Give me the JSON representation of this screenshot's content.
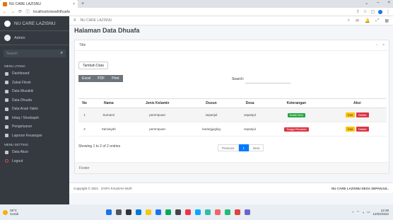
{
  "browser": {
    "tab_title": "NU CARE LAZISNU",
    "tab_close": "×",
    "new_tab": "+",
    "url": "localhost/ziswaf/dhuafa",
    "window_controls": [
      "⌄",
      "–",
      "×"
    ]
  },
  "sidebar": {
    "brand": "NU CARE LAZISNU",
    "user": "Admin",
    "search_placeholder": "Search",
    "header_menu": "MENU UTAMA",
    "items": [
      {
        "label": "Dashboard",
        "icon": "dashboard-icon"
      },
      {
        "label": "Zakat Fitrah",
        "icon": "table-icon"
      },
      {
        "label": "Data Muzakki",
        "icon": "table-icon"
      },
      {
        "label": "Data Dhuafa",
        "icon": "table-icon"
      },
      {
        "label": "Data Anak Yatim",
        "icon": "table-icon"
      },
      {
        "label": "Infaq / Shodaqoh",
        "icon": "table-icon"
      },
      {
        "label": "Pengeluaran",
        "icon": "table-icon"
      },
      {
        "label": "Laporan Keuangan",
        "icon": "table-icon"
      }
    ],
    "header_setting": "MENU SETTING",
    "items2": [
      {
        "label": "Data Akun",
        "icon": "table-icon"
      },
      {
        "label": "Logout",
        "icon": "circle-icon"
      }
    ]
  },
  "topnav": {
    "title": "NU CARE LAZISNU"
  },
  "page": {
    "heading": "Halaman Data Dhuafa",
    "card_title": "Title",
    "add_button": "Tambah Data",
    "exports": [
      "Excel",
      "PDF",
      "Print"
    ],
    "search_label": "Search:",
    "columns": [
      "No",
      "Nama",
      "Jenis Kelamin",
      "Dusun",
      "Desa",
      "Keterangan",
      "Aksi"
    ],
    "rows": [
      {
        "no": "1",
        "nama": "Sumarni",
        "jk": "perempuan",
        "dusun": "sepanjul",
        "desa": "sepanjul",
        "ket": "Sudah Kirim",
        "ket_color": "#28a745"
      },
      {
        "no": "2",
        "nama": "Samaiyah",
        "jk": "perempuan",
        "dusun": "karangjoglog",
        "desa": "sepanjul",
        "ket": "Tunggu Pencairan",
        "ket_color": "#dc3545"
      }
    ],
    "edit_label": "Edit",
    "delete_label": "Delete",
    "showing": "Showing 1 to 2 of 2 entries",
    "pager": [
      "Previous",
      "1",
      "Next"
    ],
    "card_footer": "Footer"
  },
  "footer": {
    "left": "Copyright © 2021 . SYIFA FAUZIAH NUR",
    "right": "NU CARE LAZISNU DESA SEPANJUL."
  },
  "taskbar": {
    "temp": "29°C",
    "weather": "Cerah",
    "time": "12:39",
    "date": "12/02/2022"
  }
}
